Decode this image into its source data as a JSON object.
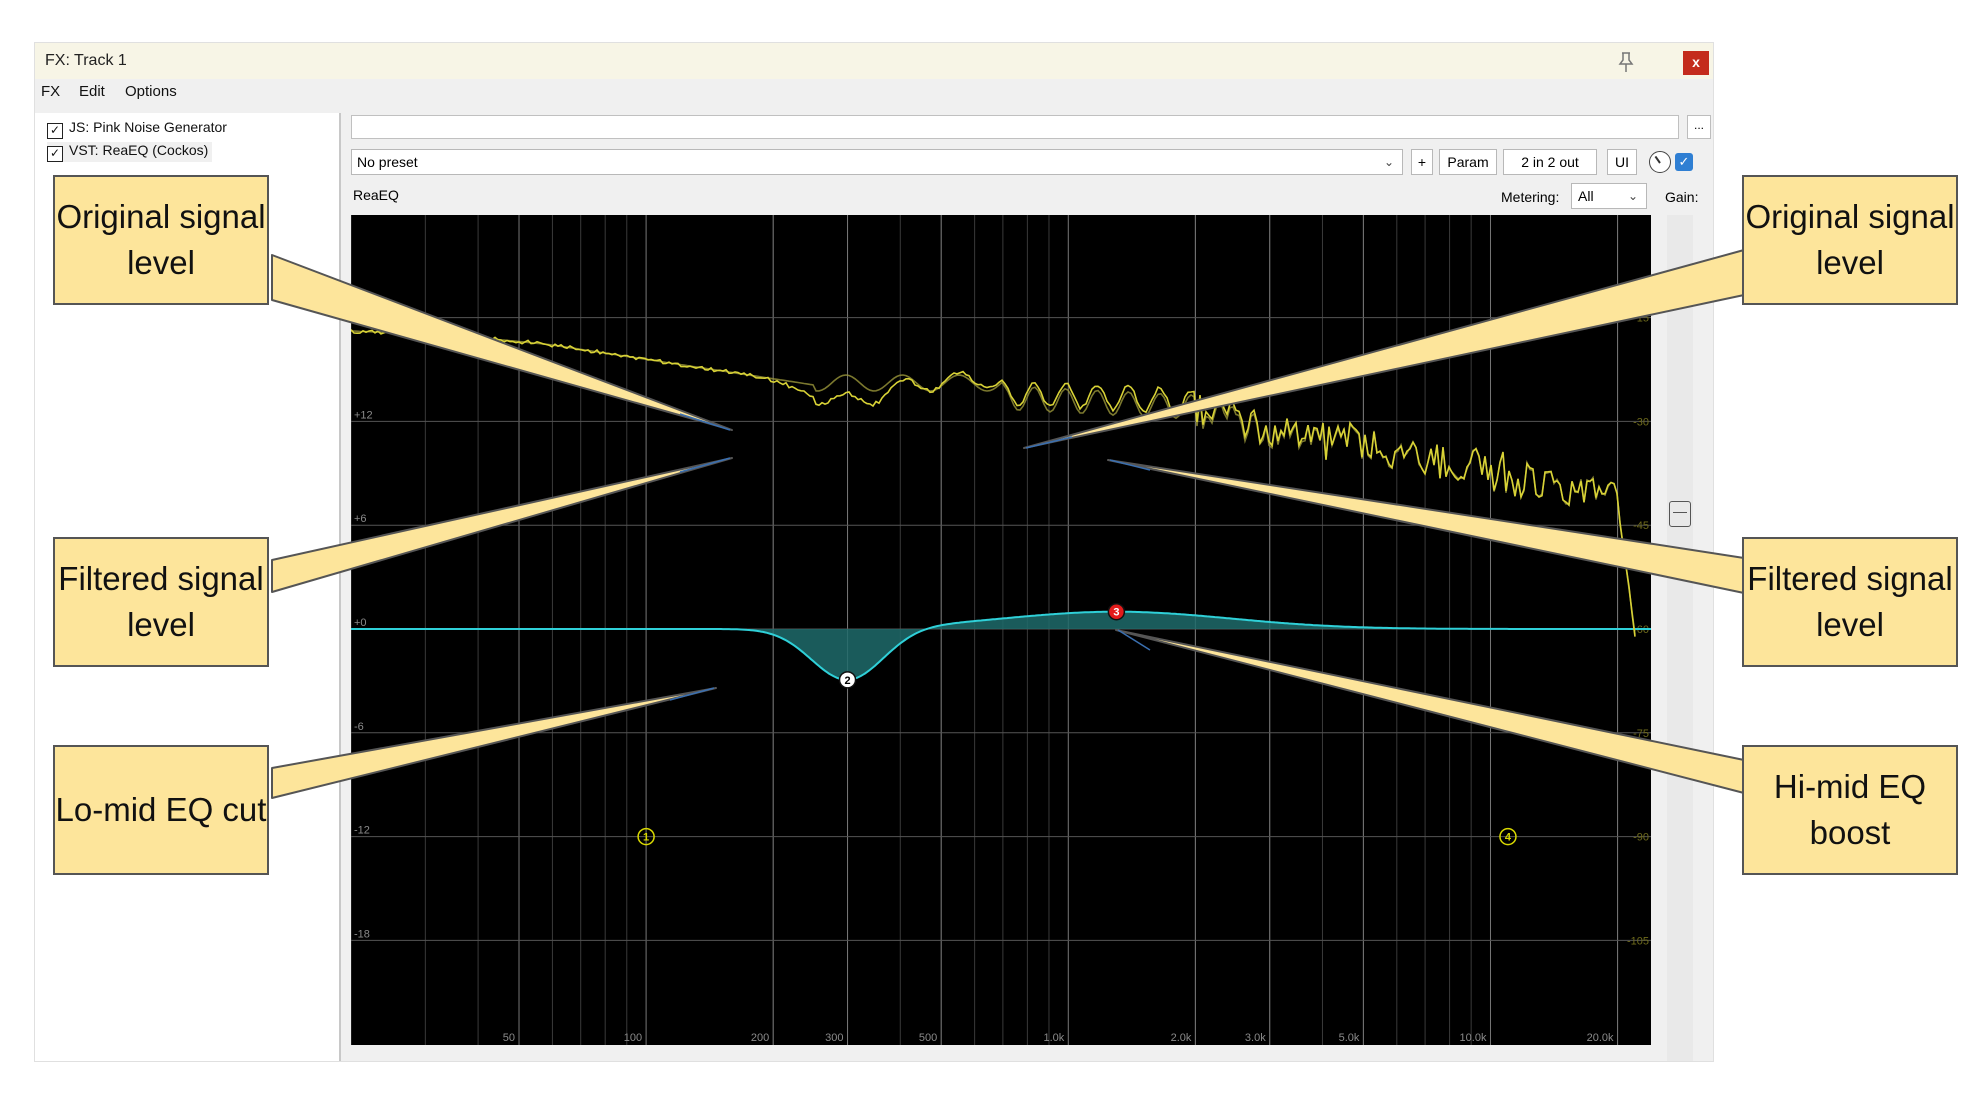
{
  "window": {
    "title": "FX: Track 1",
    "close_label": "x"
  },
  "menu": [
    "FX",
    "Edit",
    "Options"
  ],
  "fx_chain": [
    {
      "label": "JS: Pink Noise Generator",
      "checked": true
    },
    {
      "label": "VST: ReaEQ (Cockos)",
      "checked": true
    }
  ],
  "toolbar": {
    "more_label": "...",
    "preset": "No preset",
    "add_label": "+",
    "param_label": "Param",
    "io_label": "2 in 2 out",
    "ui_label": "UI"
  },
  "plugin": {
    "name": "ReaEQ",
    "metering_label": "Metering:",
    "metering_value": "All",
    "gain_label": "Gain:"
  },
  "graph": {
    "freq_labels": [
      "50",
      "100",
      "200",
      "300",
      "500",
      "1.0k",
      "2.0k",
      "3.0k",
      "5.0k",
      "10.0k",
      "20.0k"
    ],
    "freq_values": [
      50,
      100,
      200,
      300,
      500,
      1000,
      2000,
      3000,
      5000,
      10000,
      20000
    ],
    "db_labels": [
      "+12",
      "+6",
      "+0",
      "-6",
      "-12",
      "-18"
    ],
    "db_values": [
      12,
      6,
      0,
      -6,
      -12,
      -18
    ],
    "meter_labels": [
      "-15",
      "-30",
      "-45",
      "-60",
      "-75",
      "-90",
      "-105"
    ],
    "bands": [
      {
        "id": "1",
        "freq": 100,
        "gain": -12,
        "color": "#d9d900",
        "active": false
      },
      {
        "id": "2",
        "freq": 300,
        "gain": -3,
        "color": "#ffffff",
        "active": true
      },
      {
        "id": "3",
        "freq": 1300,
        "gain": 1,
        "color": "#e21b1b",
        "active": true
      },
      {
        "id": "4",
        "freq": 11000,
        "gain": -12,
        "color": "#d9d900",
        "active": false
      }
    ],
    "eq_curve_color": "#2fd0d8",
    "signal_color": "#d8d236"
  },
  "callouts": {
    "left": [
      "Original signal level",
      "Filtered signal level",
      "Lo-mid EQ cut"
    ],
    "right": [
      "Original signal level",
      "Filtered signal level",
      "Hi-mid EQ boost"
    ]
  }
}
